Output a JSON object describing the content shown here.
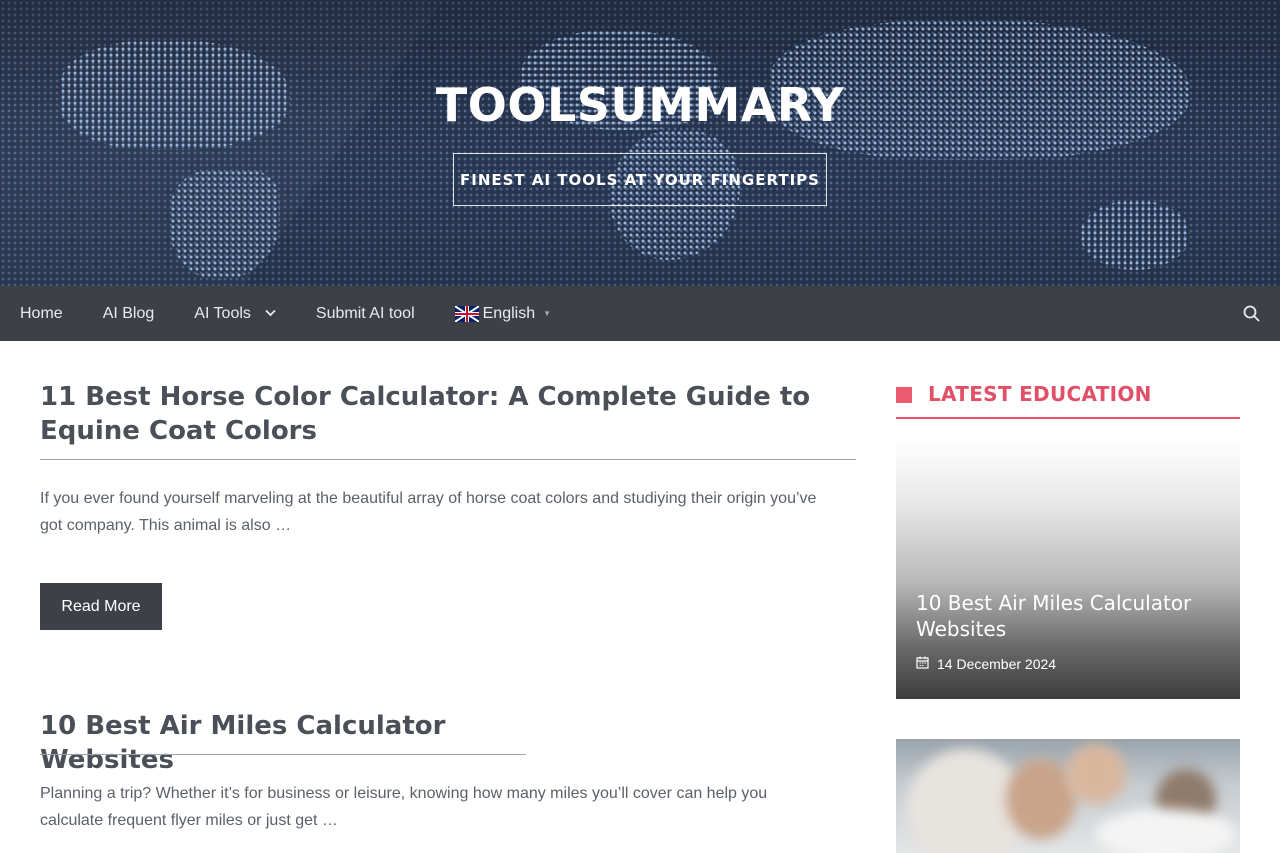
{
  "site": {
    "title": "TOOLSUMMARY",
    "tagline": "FINEST AI TOOLS AT YOUR FINGERTIPS"
  },
  "nav": {
    "items": [
      {
        "label": "Home"
      },
      {
        "label": "AI Blog"
      },
      {
        "label": "AI Tools"
      },
      {
        "label": "Submit AI tool"
      }
    ],
    "language": "English",
    "search_icon": "search-icon"
  },
  "posts": [
    {
      "title": "11 Best Horse Color Calculator: A Complete Guide to Equine Coat Colors",
      "excerpt": "If you ever found yourself marveling at the beautiful array of horse coat colors and studiying their origin you’ve got company. This animal is also …",
      "read_more": "Read More"
    },
    {
      "title": "10 Best Air Miles Calculator Websites",
      "excerpt": "Planning a trip? Whether it’s for business or leisure, knowing how many miles you’ll cover can help you calculate frequent flyer miles or just get …"
    }
  ],
  "sidebar": {
    "heading": "LATEST EDUCATION",
    "cards": [
      {
        "title": "10 Best Air Miles Calculator Websites",
        "date": "14 December 2024"
      }
    ]
  },
  "colors": {
    "nav_bg": "#3d4047",
    "accent": "#e05068",
    "button_bg": "#3d4047"
  }
}
